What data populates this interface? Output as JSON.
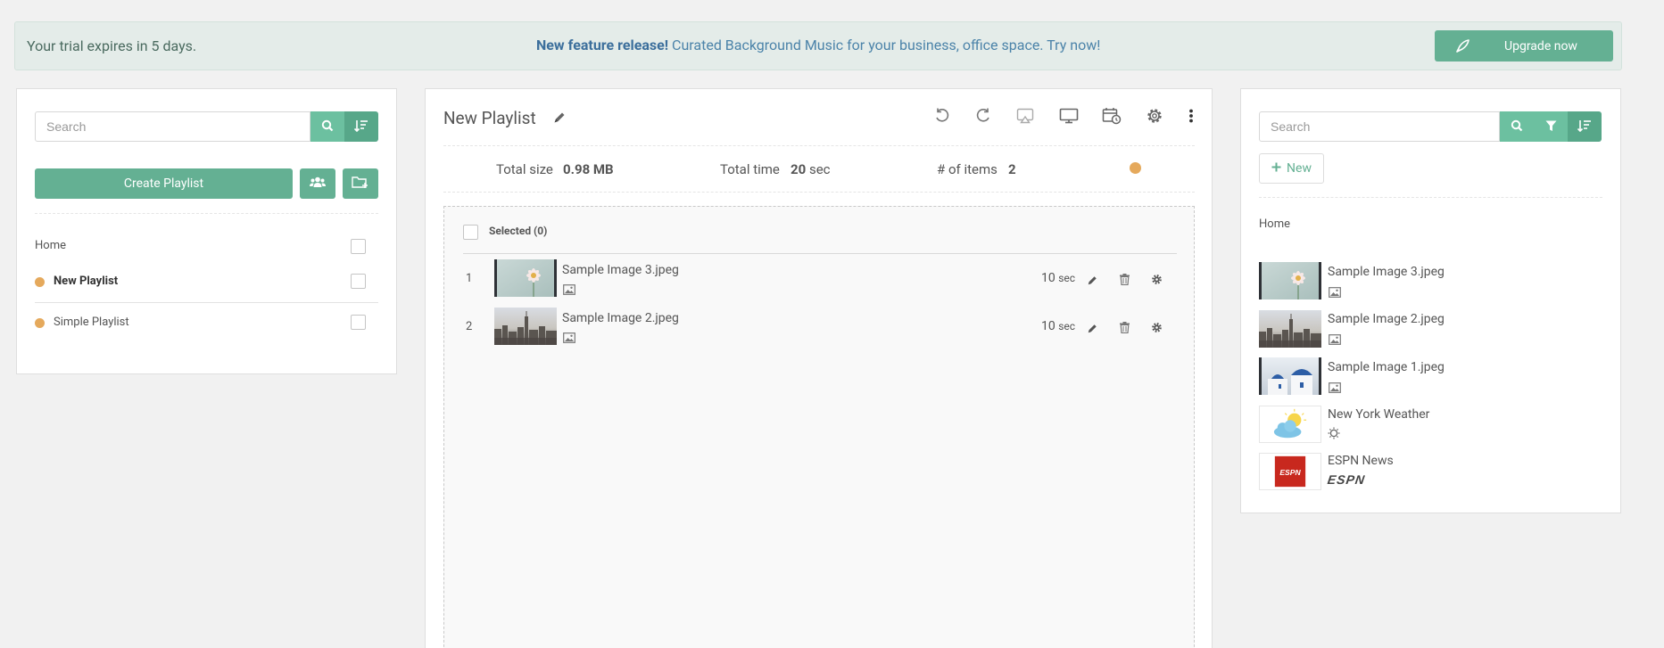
{
  "banner": {
    "trial_text": "Your trial expires in 5 days.",
    "feature_bold": "New feature release!",
    "feature_text": " Curated Background Music for your business, office space. Try now!",
    "upgrade_label": "Upgrade now"
  },
  "left_panel": {
    "search_placeholder": "Search",
    "create_playlist_label": "Create Playlist",
    "home_label": "Home",
    "playlists": [
      {
        "name": "New Playlist",
        "active": true
      },
      {
        "name": "Simple Playlist",
        "active": false
      }
    ]
  },
  "playlist": {
    "title": "New Playlist",
    "stats": {
      "total_size_label": "Total size",
      "total_size_value": "0.98 MB",
      "total_time_label": "Total time",
      "total_time_number": "20",
      "total_time_unit": "sec",
      "items_label": "# of items",
      "items_value": "2"
    },
    "selected_label": "Selected (0)",
    "items": [
      {
        "index": "1",
        "title": "Sample Image 3.jpeg",
        "duration_num": "10",
        "duration_unit": "sec",
        "thumb": "flower"
      },
      {
        "index": "2",
        "title": "Sample Image 2.jpeg",
        "duration_num": "10",
        "duration_unit": "sec",
        "thumb": "city"
      }
    ]
  },
  "right_panel": {
    "search_placeholder": "Search",
    "new_label": "New",
    "home_label": "Home",
    "media": [
      {
        "title": "Sample Image 3.jpeg",
        "thumb": "flower",
        "type_icon": "image-icon"
      },
      {
        "title": "Sample Image 2.jpeg",
        "thumb": "city",
        "type_icon": "image-icon"
      },
      {
        "title": "Sample Image 1.jpeg",
        "thumb": "santorini",
        "type_icon": "image-icon"
      },
      {
        "title": "New York Weather",
        "thumb": "weather",
        "type_icon": "sun-icon"
      },
      {
        "title": "ESPN News",
        "thumb": "espn",
        "type_icon": "espn-logo",
        "logo_text": "ESPN"
      }
    ]
  },
  "colors": {
    "accent": "#64b093",
    "status_dot": "#e5a95c",
    "banner_bg": "#e4ece9"
  }
}
